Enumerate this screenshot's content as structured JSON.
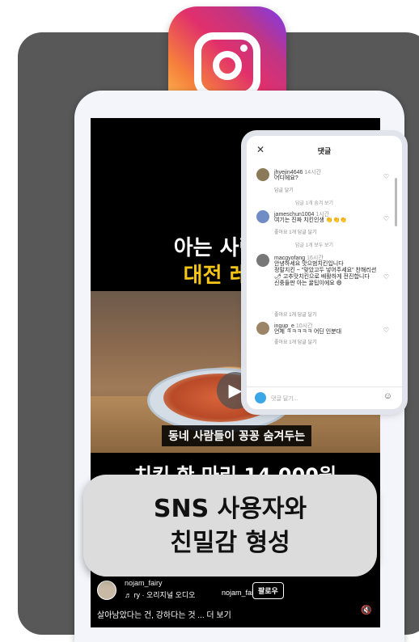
{
  "screen": {
    "headline1": "아는 사람들만",
    "headline2": "대전 레전드",
    "subtitle": "동네 사람들이 꽁꽁 숨겨두는",
    "headline3": "치킨 한 마리 14,000원",
    "username": "nojam_fairy",
    "music": "♬ ry · 오리지널 오디오",
    "tagged_user": "nojam_fai",
    "follow_label": "팔로우",
    "caption": "살아남았다는 건, 강하다는 것 ... 더 보기"
  },
  "overlay": {
    "line1": "SNS 사용자와",
    "line2": "친밀감 형성"
  },
  "comments_panel": {
    "title": "댓글",
    "close_icon": "close-icon",
    "input_placeholder": "댓글 달기...",
    "items": [
      {
        "name": "jhyejin4646",
        "time": "14시간",
        "text": "어디에요?",
        "meta": "답글 달기",
        "more": "답글 1개 숨겨 보기",
        "avatar_color": "#8b7a5a"
      },
      {
        "name": "jameschun1004",
        "time": "1시간",
        "text": "여기는 진짜 치킨인생 👏👏👏",
        "meta": "좋아요 1개   답글 달기",
        "more": "답글 1개 보두 보기",
        "avatar_color": "#6f8cc4"
      },
      {
        "name": "macgyofang",
        "time": "16시간",
        "text": "안녕하세요 맛으범치킨입니다 \n정말치킨 ~ \"맞았고두 넣어주세요\" 찬해리션 \n🌶 고추맛치킨으로 배활하게 전진합니다 \n신중들판 아는 꿀팁이에요 😄",
        "meta": "좋아요 1개   답글 달기",
        "more": "",
        "avatar_color": "#777777"
      },
      {
        "name": "ingup_e",
        "time": "10시간",
        "text": "언제 ㅋㅋㅋㅋㅋ 어딘 인분대",
        "meta": "좋아요 1개   답글 달기",
        "more": "",
        "avatar_color": "#9c8466"
      }
    ]
  }
}
